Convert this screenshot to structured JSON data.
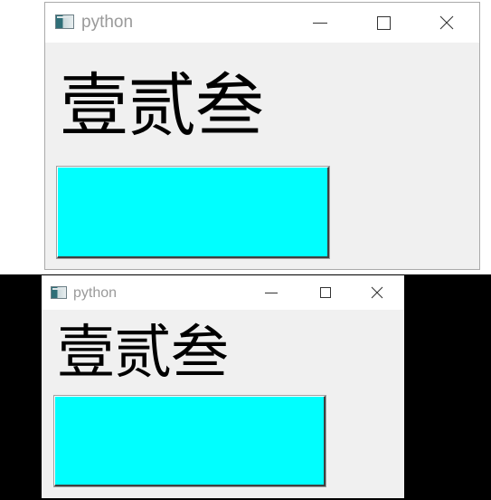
{
  "windows": [
    {
      "title": "python",
      "label_text": "壹贰叁",
      "button_color": "#00ffff",
      "icons": {
        "app": "python-window-icon",
        "minimize": "minimize-icon",
        "maximize": "maximize-icon",
        "close": "close-icon"
      }
    },
    {
      "title": "python",
      "label_text": "壹贰叁",
      "button_color": "#00ffff",
      "icons": {
        "app": "python-window-icon",
        "minimize": "minimize-icon",
        "maximize": "maximize-icon",
        "close": "close-icon"
      }
    }
  ]
}
